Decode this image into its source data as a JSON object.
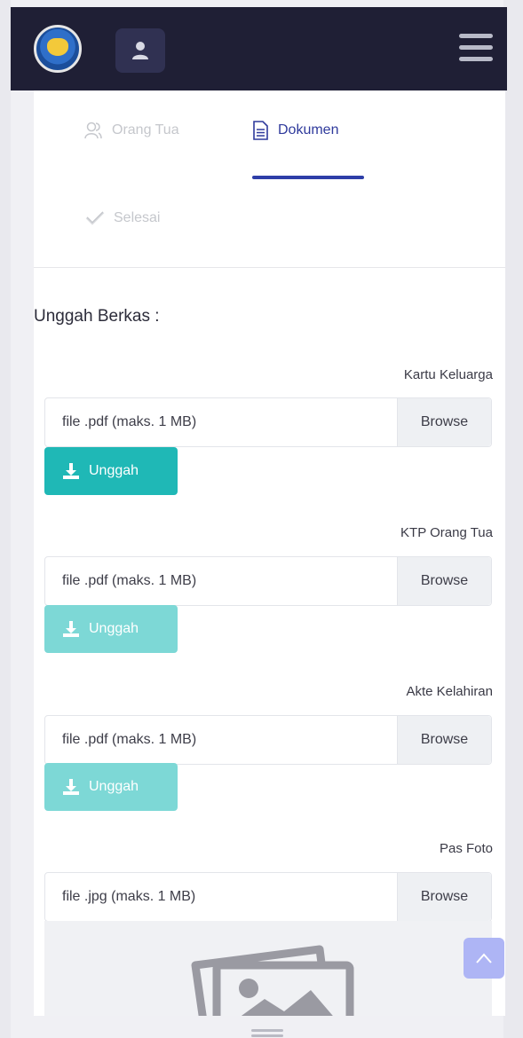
{
  "tabs": {
    "orang_tua": "Orang Tua",
    "dokumen": "Dokumen",
    "selesai": "Selesai"
  },
  "section_title": "Unggah Berkas :",
  "fields": [
    {
      "label": "Kartu Keluarga",
      "placeholder": "file .pdf (maks. 1 MB)",
      "browse": "Browse",
      "upload": "Unggah",
      "upload_state": "active"
    },
    {
      "label": "KTP Orang Tua",
      "placeholder": "file .pdf (maks. 1 MB)",
      "browse": "Browse",
      "upload": "Unggah",
      "upload_state": "disabled"
    },
    {
      "label": "Akte Kelahiran",
      "placeholder": "file .pdf (maks. 1 MB)",
      "browse": "Browse",
      "upload": "Unggah",
      "upload_state": "disabled"
    },
    {
      "label": "Pas Foto",
      "placeholder": "file .jpg (maks. 1 MB)",
      "browse": "Browse"
    }
  ],
  "icons": {
    "logo": "tut-wuri-handayani-logo",
    "user": "user-icon",
    "menu": "hamburger-menu-icon",
    "orang_tua": "users-icon",
    "dokumen": "document-icon",
    "selesai": "check-icon",
    "upload": "download-icon",
    "photo": "image-placeholder-icon",
    "scroll_top": "chevron-up-icon"
  },
  "colors": {
    "navbar": "#1f1f35",
    "active_tab": "#2f3a9c",
    "upload_active": "#1fb8b6",
    "upload_disabled": "#7dd8d6",
    "scroll_top": "#aeb5f5"
  }
}
